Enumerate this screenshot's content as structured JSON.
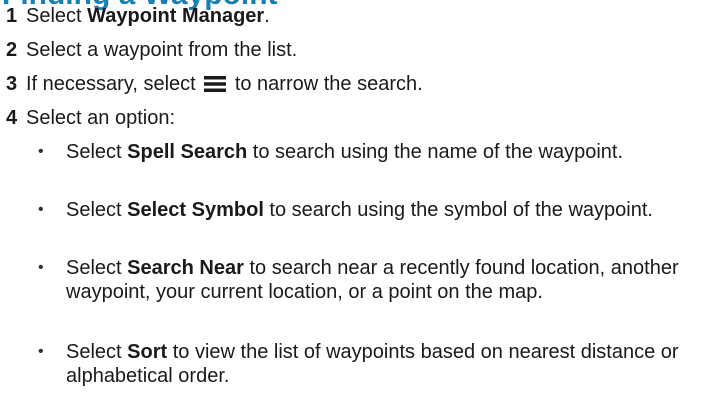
{
  "heading": "Finding a Waypoint",
  "steps": [
    {
      "num": "1",
      "pre": "Select ",
      "bold": "Waypoint Manager",
      "post": "."
    },
    {
      "num": "2",
      "text": "Select a waypoint from the list."
    },
    {
      "num": "3",
      "pre": "If necessary, select ",
      "icon": "menu-icon",
      "post": " to narrow the search."
    },
    {
      "num": "4",
      "text": "Select an option:"
    }
  ],
  "options": [
    {
      "bullet": "•",
      "pre": "Select ",
      "bold": "Spell Search",
      "post": " to search using the name of the waypoint."
    },
    {
      "bullet": "•",
      "pre": "Select ",
      "bold": "Select Symbol",
      "post": " to search using the symbol of the waypoint."
    },
    {
      "bullet": "•",
      "pre": "Select ",
      "bold": "Search Near",
      "post": " to search near a recently found location, another waypoint, your current location, or a point on the map."
    },
    {
      "bullet": "•",
      "pre": "Select ",
      "bold": "Sort",
      "post": " to view the list of waypoints based on nearest distance or alphabetical order."
    }
  ]
}
